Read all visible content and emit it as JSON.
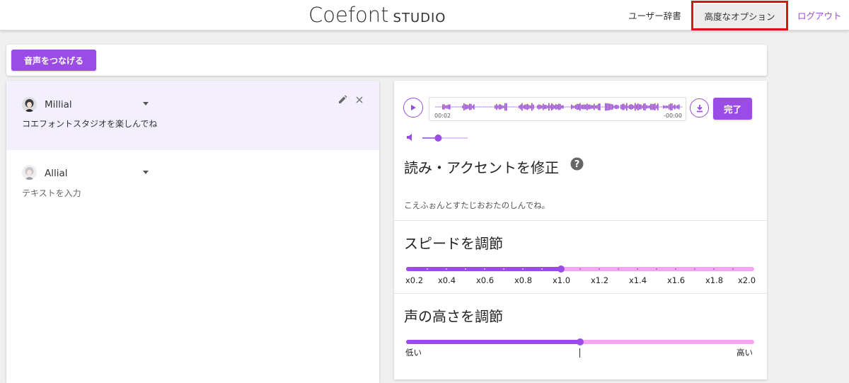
{
  "header": {
    "logo_main": "Coefont",
    "logo_sub": "STUDIO",
    "nav": {
      "user_dictionary": "ユーザー辞書",
      "advanced_options": "高度なオプション",
      "logout": "ログアウト"
    }
  },
  "toolbar": {
    "join_button": "音声をつなげる"
  },
  "lines": [
    {
      "voice": "Millial",
      "text": "コエフォントスタジオを楽しんでね",
      "placeholder": "",
      "active": true
    },
    {
      "voice": "Allial",
      "text": "",
      "placeholder": "テキストを入力",
      "active": false
    }
  ],
  "player": {
    "elapsed": "00:02",
    "remaining": "-00:00",
    "done_button": "完了",
    "volume_fraction": 0.35
  },
  "accent": {
    "title": "読み・アクセントを修正",
    "reading": "こえふぉんとすたじおおたのしんでね。"
  },
  "speed": {
    "title": "スピードを調節",
    "ticks": [
      "x0.2",
      "x0.4",
      "x0.6",
      "x0.8",
      "x1.0",
      "x1.2",
      "x1.4",
      "x1.6",
      "x1.8",
      "x2.0"
    ],
    "value": 1.0,
    "min": 0.2,
    "max": 2.0
  },
  "pitch": {
    "title": "声の高さを調節",
    "low_label": "低い",
    "high_label": "高い",
    "value_fraction": 0.5
  },
  "colors": {
    "accent": "#9b4be6",
    "track_light": "#f4a6f0",
    "highlight_border": "#d8161c"
  }
}
